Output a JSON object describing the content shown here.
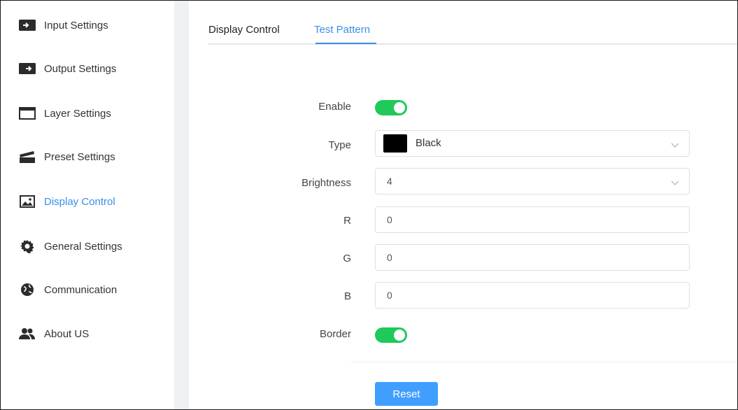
{
  "sidebar": {
    "items": [
      {
        "label": "Input Settings",
        "icon": "input-icon"
      },
      {
        "label": "Output Settings",
        "icon": "output-icon"
      },
      {
        "label": "Layer Settings",
        "icon": "layer-window-icon"
      },
      {
        "label": "Preset Settings",
        "icon": "clapperboard-icon"
      },
      {
        "label": "Display Control",
        "icon": "image-icon",
        "active": true
      },
      {
        "label": "General Settings",
        "icon": "gear-icon"
      },
      {
        "label": "Communication",
        "icon": "globe-icon"
      },
      {
        "label": "About US",
        "icon": "users-icon"
      }
    ]
  },
  "tabs": {
    "display_control": "Display Control",
    "test_pattern": "Test Pattern",
    "active": "Test Pattern"
  },
  "form": {
    "enable_label": "Enable",
    "enable_on": true,
    "type_label": "Type",
    "type_value": "Black",
    "type_swatch_color": "#000000",
    "brightness_label": "Brightness",
    "brightness_value": "4",
    "r_label": "R",
    "r_value": "0",
    "g_label": "G",
    "g_value": "0",
    "b_label": "B",
    "b_value": "0",
    "border_label": "Border",
    "border_on": true,
    "reset_label": "Reset"
  },
  "colors": {
    "accent": "#3a8ee6",
    "toggle_on": "#1fc95a",
    "button": "#409eff",
    "gutter": "#eef0f3"
  }
}
